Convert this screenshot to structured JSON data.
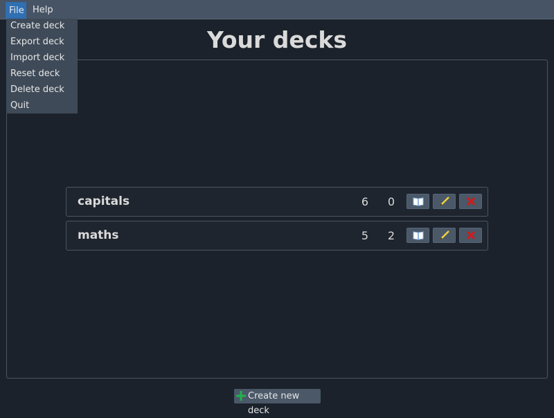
{
  "menubar": {
    "file": "File",
    "help": "Help"
  },
  "file_menu": {
    "items": [
      "Create deck",
      "Export deck",
      "Import deck",
      "Reset deck",
      "Delete deck",
      "Quit"
    ]
  },
  "page": {
    "title": "Your decks"
  },
  "decks": [
    {
      "name": "capitals",
      "count_a": "6",
      "count_b": "0"
    },
    {
      "name": "maths",
      "count_a": "5",
      "count_b": "2"
    }
  ],
  "actions": {
    "create_label": "Create new deck"
  },
  "icons": {
    "study": "open-book-icon",
    "edit": "pencil-icon",
    "delete": "red-x-icon",
    "create": "green-plus-icon"
  },
  "colors": {
    "accent": "#2f6fb2",
    "delete": "#d11a1a",
    "plus": "#22b14c"
  }
}
